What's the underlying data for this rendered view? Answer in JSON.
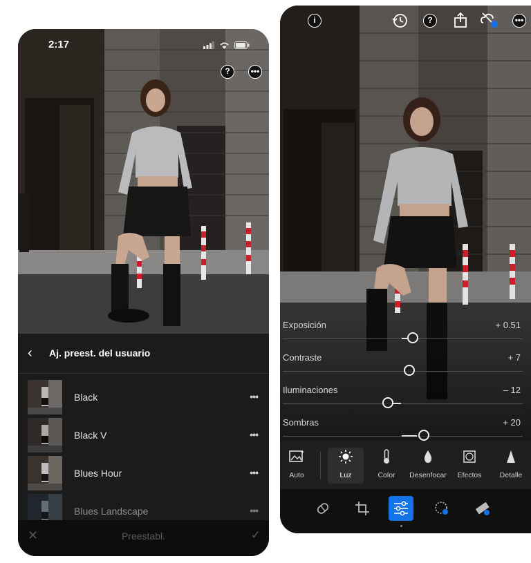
{
  "left_screen": {
    "status": {
      "time": "2:17"
    },
    "header": {
      "back_label": "‹",
      "title": "Aj. preest. del usuario"
    },
    "presets": [
      {
        "name": "Black",
        "more": "•••"
      },
      {
        "name": "Black V",
        "more": "•••"
      },
      {
        "name": "Blues Hour",
        "more": "•••"
      },
      {
        "name": "Blues Landscape",
        "more": "•••"
      }
    ],
    "bottom_bar": {
      "cancel": "✕",
      "label": "Preestabl.",
      "confirm": "✓"
    }
  },
  "right_screen": {
    "sliders": [
      {
        "name": "Exposición",
        "value": "+ 0.51",
        "level": 0.51
      },
      {
        "name": "Contraste",
        "value": "+ 7",
        "level": 7
      },
      {
        "name": "Iluminaciones",
        "value": "– 12",
        "level": -12
      },
      {
        "name": "Sombras",
        "value": "+ 20",
        "level": 20
      }
    ],
    "tools": [
      {
        "label": "Auto",
        "icon": "auto-icon"
      },
      {
        "label": "Luz",
        "icon": "light-icon",
        "selected": true
      },
      {
        "label": "Color",
        "icon": "thermometer-icon"
      },
      {
        "label": "Desenfocar",
        "icon": "drop-icon"
      },
      {
        "label": "Efectos",
        "icon": "effects-icon"
      },
      {
        "label": "Detalle",
        "icon": "detail-icon"
      }
    ],
    "bottom_icons": [
      "healing-icon",
      "crop-icon",
      "adjust-icon",
      "masking-icon",
      "eraser-icon"
    ]
  },
  "colors": {
    "accent": "#1473e6",
    "panel": "#1b1b1b",
    "bollard_red": "#c8202a"
  }
}
